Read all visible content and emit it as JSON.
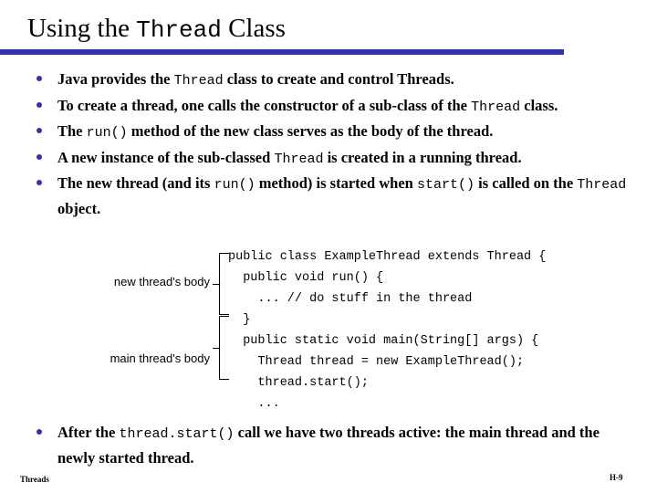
{
  "slide": {
    "title_prefix": "Using the ",
    "title_mono": "Thread",
    "title_suffix": " Class",
    "accent_color": "#3333a8"
  },
  "bullets_top": [
    {
      "parts": [
        {
          "t": "Java provides the ",
          "mono": false
        },
        {
          "t": "Thread",
          "mono": true
        },
        {
          "t": " class to create and control Threads.",
          "mono": false
        }
      ]
    },
    {
      "parts": [
        {
          "t": "To create a thread, one calls the constructor of a sub-class of the ",
          "mono": false
        },
        {
          "t": "Thread",
          "mono": true
        },
        {
          "t": " class.",
          "mono": false
        }
      ]
    },
    {
      "parts": [
        {
          "t": "The ",
          "mono": false
        },
        {
          "t": "run()",
          "mono": true
        },
        {
          "t": " method of the new class serves as the body of the thread.",
          "mono": false
        }
      ]
    },
    {
      "parts": [
        {
          "t": "A new instance of the sub-classed ",
          "mono": false
        },
        {
          "t": "Thread",
          "mono": true
        },
        {
          "t": " is created in a running thread.",
          "mono": false
        }
      ]
    },
    {
      "parts": [
        {
          "t": "The new thread (and its ",
          "mono": false
        },
        {
          "t": "run()",
          "mono": true
        },
        {
          "t": " method) is started when ",
          "mono": false
        },
        {
          "t": "start()",
          "mono": true
        },
        {
          "t": " is called on the ",
          "mono": false
        },
        {
          "t": "Thread",
          "mono": true
        },
        {
          "t": " object.",
          "mono": false
        }
      ]
    }
  ],
  "bullets_bottom": [
    {
      "parts": [
        {
          "t": "After the ",
          "mono": false
        },
        {
          "t": "thread.start()",
          "mono": true
        },
        {
          "t": " call we have two threads active:  the main thread and the newly started thread.",
          "mono": false
        }
      ]
    }
  ],
  "code": {
    "language": "java",
    "lines": [
      "public class ExampleThread extends Thread {",
      "  public void run() {",
      "    ... // do stuff in the thread",
      "  }",
      "  public static void main(String[] args) {",
      "    Thread thread = new ExampleThread();",
      "    thread.start();",
      "    ..."
    ],
    "text": "public class ExampleThread extends Thread {\n  public void run() {\n    ... // do stuff in the thread\n  }\n  public static void main(String[] args) {\n    Thread thread = new ExampleThread();\n    thread.start();\n    ..."
  },
  "annotations": [
    {
      "label": "new thread's body"
    },
    {
      "label": "main thread's body"
    }
  ],
  "footer": {
    "left": "Threads",
    "right": "H-9"
  }
}
